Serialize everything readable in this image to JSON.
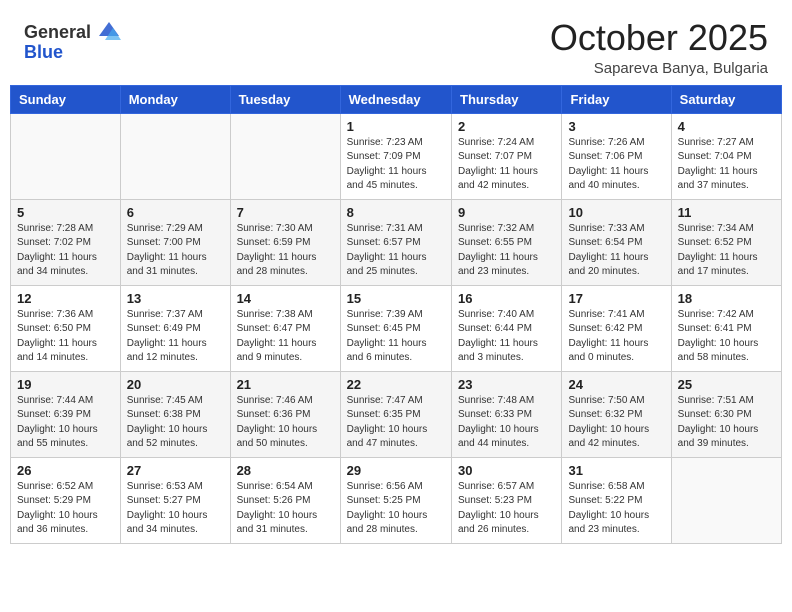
{
  "header": {
    "logo_general": "General",
    "logo_blue": "Blue",
    "month_title": "October 2025",
    "subtitle": "Sapareva Banya, Bulgaria"
  },
  "days_of_week": [
    "Sunday",
    "Monday",
    "Tuesday",
    "Wednesday",
    "Thursday",
    "Friday",
    "Saturday"
  ],
  "weeks": [
    [
      {
        "day": "",
        "info": ""
      },
      {
        "day": "",
        "info": ""
      },
      {
        "day": "",
        "info": ""
      },
      {
        "day": "1",
        "info": "Sunrise: 7:23 AM\nSunset: 7:09 PM\nDaylight: 11 hours and 45 minutes."
      },
      {
        "day": "2",
        "info": "Sunrise: 7:24 AM\nSunset: 7:07 PM\nDaylight: 11 hours and 42 minutes."
      },
      {
        "day": "3",
        "info": "Sunrise: 7:26 AM\nSunset: 7:06 PM\nDaylight: 11 hours and 40 minutes."
      },
      {
        "day": "4",
        "info": "Sunrise: 7:27 AM\nSunset: 7:04 PM\nDaylight: 11 hours and 37 minutes."
      }
    ],
    [
      {
        "day": "5",
        "info": "Sunrise: 7:28 AM\nSunset: 7:02 PM\nDaylight: 11 hours and 34 minutes."
      },
      {
        "day": "6",
        "info": "Sunrise: 7:29 AM\nSunset: 7:00 PM\nDaylight: 11 hours and 31 minutes."
      },
      {
        "day": "7",
        "info": "Sunrise: 7:30 AM\nSunset: 6:59 PM\nDaylight: 11 hours and 28 minutes."
      },
      {
        "day": "8",
        "info": "Sunrise: 7:31 AM\nSunset: 6:57 PM\nDaylight: 11 hours and 25 minutes."
      },
      {
        "day": "9",
        "info": "Sunrise: 7:32 AM\nSunset: 6:55 PM\nDaylight: 11 hours and 23 minutes."
      },
      {
        "day": "10",
        "info": "Sunrise: 7:33 AM\nSunset: 6:54 PM\nDaylight: 11 hours and 20 minutes."
      },
      {
        "day": "11",
        "info": "Sunrise: 7:34 AM\nSunset: 6:52 PM\nDaylight: 11 hours and 17 minutes."
      }
    ],
    [
      {
        "day": "12",
        "info": "Sunrise: 7:36 AM\nSunset: 6:50 PM\nDaylight: 11 hours and 14 minutes."
      },
      {
        "day": "13",
        "info": "Sunrise: 7:37 AM\nSunset: 6:49 PM\nDaylight: 11 hours and 12 minutes."
      },
      {
        "day": "14",
        "info": "Sunrise: 7:38 AM\nSunset: 6:47 PM\nDaylight: 11 hours and 9 minutes."
      },
      {
        "day": "15",
        "info": "Sunrise: 7:39 AM\nSunset: 6:45 PM\nDaylight: 11 hours and 6 minutes."
      },
      {
        "day": "16",
        "info": "Sunrise: 7:40 AM\nSunset: 6:44 PM\nDaylight: 11 hours and 3 minutes."
      },
      {
        "day": "17",
        "info": "Sunrise: 7:41 AM\nSunset: 6:42 PM\nDaylight: 11 hours and 0 minutes."
      },
      {
        "day": "18",
        "info": "Sunrise: 7:42 AM\nSunset: 6:41 PM\nDaylight: 10 hours and 58 minutes."
      }
    ],
    [
      {
        "day": "19",
        "info": "Sunrise: 7:44 AM\nSunset: 6:39 PM\nDaylight: 10 hours and 55 minutes."
      },
      {
        "day": "20",
        "info": "Sunrise: 7:45 AM\nSunset: 6:38 PM\nDaylight: 10 hours and 52 minutes."
      },
      {
        "day": "21",
        "info": "Sunrise: 7:46 AM\nSunset: 6:36 PM\nDaylight: 10 hours and 50 minutes."
      },
      {
        "day": "22",
        "info": "Sunrise: 7:47 AM\nSunset: 6:35 PM\nDaylight: 10 hours and 47 minutes."
      },
      {
        "day": "23",
        "info": "Sunrise: 7:48 AM\nSunset: 6:33 PM\nDaylight: 10 hours and 44 minutes."
      },
      {
        "day": "24",
        "info": "Sunrise: 7:50 AM\nSunset: 6:32 PM\nDaylight: 10 hours and 42 minutes."
      },
      {
        "day": "25",
        "info": "Sunrise: 7:51 AM\nSunset: 6:30 PM\nDaylight: 10 hours and 39 minutes."
      }
    ],
    [
      {
        "day": "26",
        "info": "Sunrise: 6:52 AM\nSunset: 5:29 PM\nDaylight: 10 hours and 36 minutes."
      },
      {
        "day": "27",
        "info": "Sunrise: 6:53 AM\nSunset: 5:27 PM\nDaylight: 10 hours and 34 minutes."
      },
      {
        "day": "28",
        "info": "Sunrise: 6:54 AM\nSunset: 5:26 PM\nDaylight: 10 hours and 31 minutes."
      },
      {
        "day": "29",
        "info": "Sunrise: 6:56 AM\nSunset: 5:25 PM\nDaylight: 10 hours and 28 minutes."
      },
      {
        "day": "30",
        "info": "Sunrise: 6:57 AM\nSunset: 5:23 PM\nDaylight: 10 hours and 26 minutes."
      },
      {
        "day": "31",
        "info": "Sunrise: 6:58 AM\nSunset: 5:22 PM\nDaylight: 10 hours and 23 minutes."
      },
      {
        "day": "",
        "info": ""
      }
    ]
  ]
}
